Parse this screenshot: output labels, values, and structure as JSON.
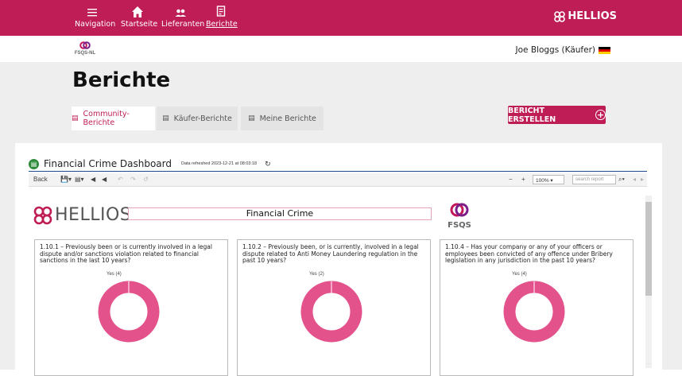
{
  "nav": {
    "items": [
      {
        "label": "Navigation",
        "icon": "menu-icon"
      },
      {
        "label": "Startseite",
        "icon": "home-icon"
      },
      {
        "label": "Lieferanten",
        "icon": "users-icon"
      },
      {
        "label": "Berichte",
        "icon": "report-icon",
        "active": true
      }
    ],
    "brand": "HELLIOS"
  },
  "subheader": {
    "org_logo_text": "FSQS-NL",
    "user": "Joe Bloggs (Käufer)"
  },
  "page": {
    "title": "Berichte",
    "tabs": [
      {
        "label": "Community-Berichte",
        "active": true
      },
      {
        "label": "Käufer-Berichte"
      },
      {
        "label": "Meine Berichte"
      }
    ],
    "create_button": "BERICHT ERSTELLEN"
  },
  "report": {
    "title": "Financial Crime Dashboard",
    "refreshed": "Data refreshed 2023-12-21 at 08:03:18",
    "toolbar": {
      "back": "Back",
      "zoom": "100%",
      "search_placeholder": "search report"
    },
    "logo_text": "HELLIOS",
    "header_box": "Financial Crime",
    "fsqs_text": "FSQS",
    "questions": [
      {
        "text": "1.10.1 – Previously been or is currently involved in a legal dispute and/or sanctions violation related to financial sanctions in the last 10 years?",
        "yes_label": "Yes (4)"
      },
      {
        "text": "1.10.2 – Previously been, or is currently, involved in a legal dispute related to Anti Money Laundering regulation in the past 10 years?",
        "yes_label": "Yes (2)"
      },
      {
        "text": "1.10.4 – Has your company or any of your officers or employees been convicted of any offence under Bribery legislation in any jurisdiction in the past 10 years?",
        "yes_label": "Yes (4)"
      }
    ]
  },
  "colors": {
    "brand": "#bf1d55",
    "donut": "#e4528c"
  }
}
